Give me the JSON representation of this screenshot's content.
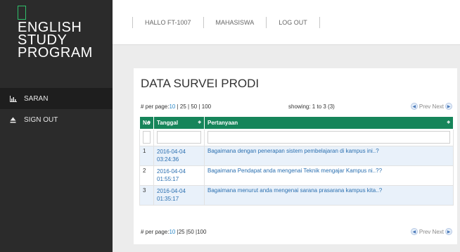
{
  "sidebar": {
    "brand": [
      "ENGLISH",
      "STUDY",
      "PROGRAM"
    ],
    "items": [
      {
        "label": "SARAN",
        "icon": "chart-icon",
        "active": true
      },
      {
        "label": "SIGN OUT",
        "icon": "eject-icon",
        "active": false
      }
    ]
  },
  "topnav": {
    "items": [
      "HALLO FT-1007",
      "MAHASISWA",
      "LOG OUT"
    ]
  },
  "panel": {
    "title": "DATA SURVEI PRODI",
    "per_page_label": "# per page:",
    "per_page_selected": "10",
    "per_page_rest": " | 25 | 50 | 100",
    "showing": "showing: 1 to 3 (3)",
    "prev": "Prev",
    "next": "Next",
    "columns": [
      "No",
      "Tanggal",
      "Pertanyaan"
    ],
    "rows": [
      {
        "no": "1",
        "date": "2016-04-04",
        "time": "03:24:36",
        "question": "Bagaimana dengan penerapan sistem pembelajaran di kampus ini..?"
      },
      {
        "no": "2",
        "date": "2016-04-04",
        "time": "01:55:17",
        "question": "Bagaimana Pendapat anda mengenai Teknik mengajar Kampus ni..??"
      },
      {
        "no": "3",
        "date": "2016-04-04",
        "time": "01:35:17",
        "question": "Bagaimana menurut anda mengenai sarana prasarana kampus kita..?"
      }
    ],
    "footer_per_page_label": "# per page:",
    "footer_per_page_selected": "10",
    "footer_per_page_rest": " |25 |50 |100"
  },
  "colors": {
    "sidebar_bg": "#2b2b2b",
    "accent_green": "#16855a",
    "link_blue": "#2a88c8",
    "row_alt": "#e9f1fa"
  }
}
